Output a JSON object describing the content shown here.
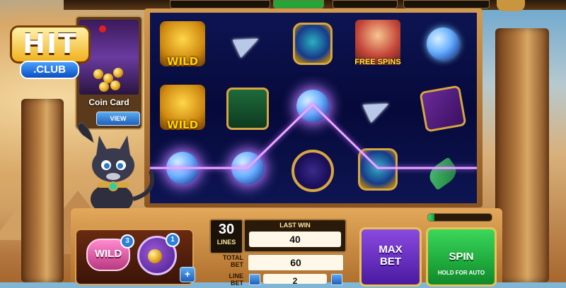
{
  "logo": {
    "hit": "HIT",
    "club": ".CLUB"
  },
  "coin_card": {
    "label": "Coin Card",
    "view_label": "VIEW"
  },
  "reels": {
    "columns": [
      [
        "wild",
        "wild",
        "yarn"
      ],
      [
        "plane",
        "mouse",
        "yarn"
      ],
      [
        "scarab",
        "yarn",
        "gyroscope"
      ],
      [
        "free-spins",
        "plane",
        "scarab"
      ],
      [
        "yarn",
        "snake",
        "lotus"
      ]
    ],
    "wild_label": "WILD",
    "free_spins_label": "FREE SPINS"
  },
  "boosts": {
    "wild_label": "WILD",
    "wild_count": "3",
    "coin_count": "1",
    "plus": "+"
  },
  "bet_panel": {
    "lines_value": "30",
    "lines_label": "LINES",
    "last_win_label": "LAST WIN",
    "last_win_value": "40",
    "total_bet_label": "TOTAL\nBET",
    "total_bet_value": "60",
    "line_bet_label": "LINE\nBET",
    "line_bet_value": "2"
  },
  "buttons": {
    "max_bet": "MAX\nBET",
    "spin": "SPIN",
    "spin_sub": "HOLD FOR AUTO"
  },
  "progress": {
    "fraction": 0.1
  },
  "colors": {
    "win_line": "#e9a8ff",
    "spin": "#1fb540",
    "max_bet": "#6a2ad0"
  }
}
